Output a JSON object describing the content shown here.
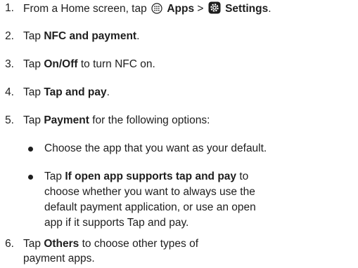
{
  "steps": [
    {
      "number": "1.",
      "t1": "From a Home screen, tap ",
      "b1": "Apps",
      "t2": " > ",
      "b2": "Settings",
      "t3": ".",
      "icons": [
        "apps-icon",
        "settings-gear-icon"
      ]
    },
    {
      "number": "2.",
      "t1": "Tap ",
      "b1": "NFC and payment",
      "t2": "."
    },
    {
      "number": "3.",
      "t1": "Tap ",
      "b1": "On/Off",
      "t2": " to turn NFC on."
    },
    {
      "number": "4.",
      "t1": "Tap ",
      "b1": "Tap and pay",
      "t2": "."
    },
    {
      "number": "5.",
      "t1": "Tap ",
      "b1": "Payment",
      "t2": " for the following options:"
    },
    {
      "number": "6.",
      "line1_t1": "Tap ",
      "line1_b1": "Others",
      "line1_t2": " to choose other types of",
      "line2": "payment apps."
    }
  ],
  "sub_items": [
    {
      "line1": "Choose the app that you want as your default."
    },
    {
      "line1_t1": "Tap ",
      "line1_b1": "If open app supports tap and pay",
      "line1_t2": " to",
      "line2": "choose whether you want to always use the",
      "line3": "default payment application, or use an open",
      "line4": "app if it supports Tap and pay."
    }
  ]
}
